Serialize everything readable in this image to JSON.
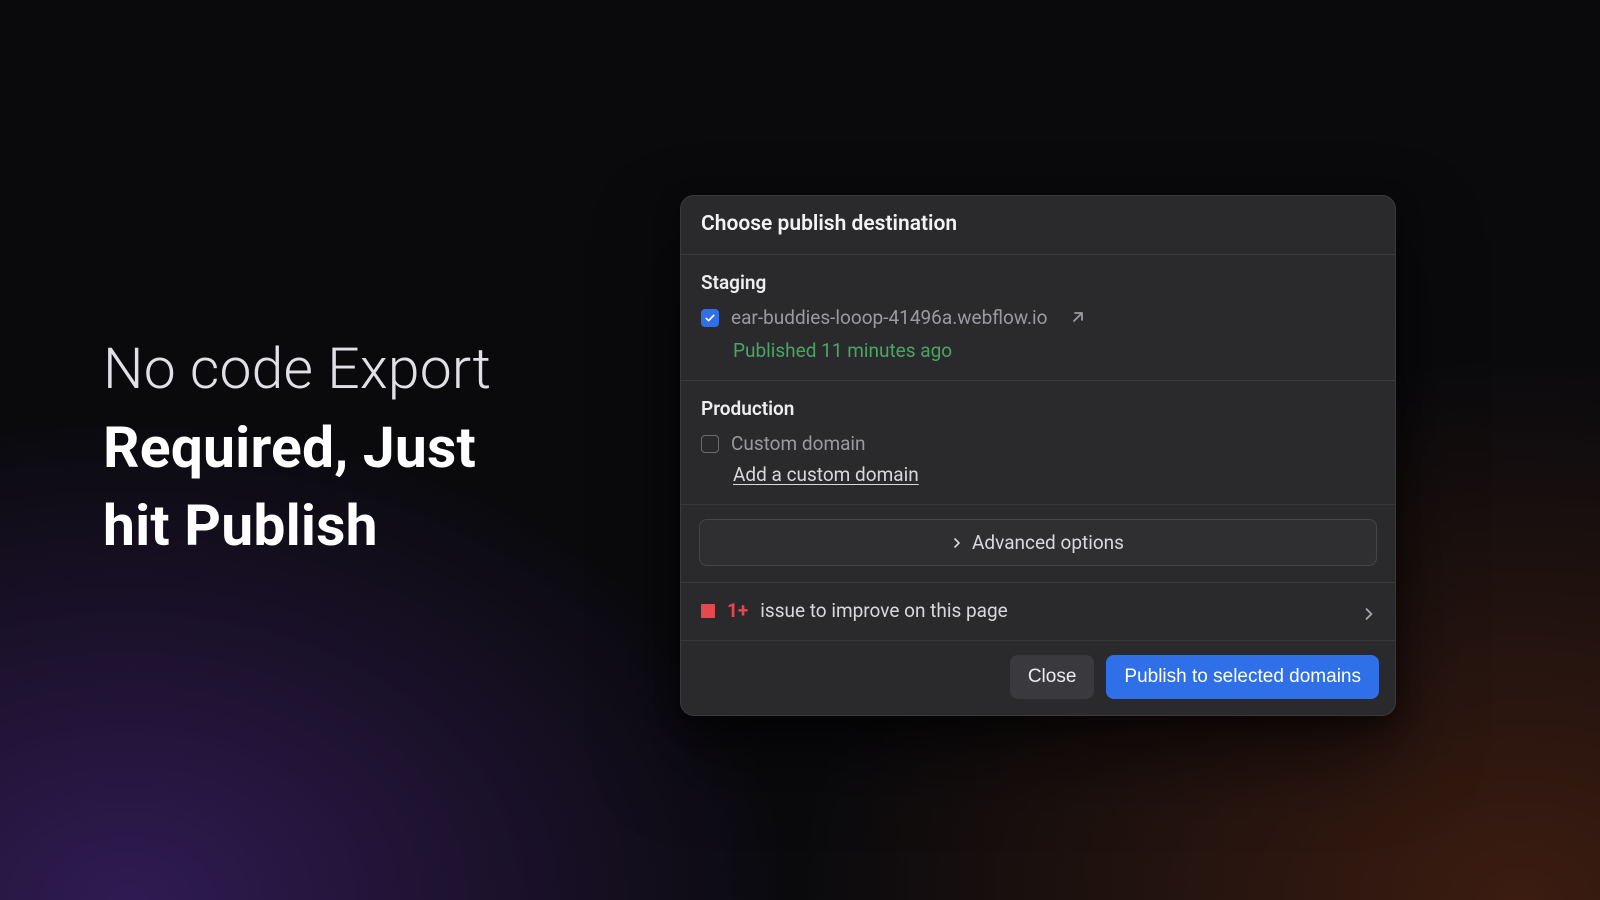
{
  "headline": {
    "line1": "No code Export",
    "line2": "Required, Just",
    "line3": "hit Publish"
  },
  "panel": {
    "title": "Choose publish destination",
    "staging": {
      "heading": "Staging",
      "checked": true,
      "domain": "ear-buddies-looop-41496a.webflow.io",
      "published_status": "Published 11 minutes ago"
    },
    "production": {
      "heading": "Production",
      "checked": false,
      "custom_domain_label": "Custom domain",
      "add_link": "Add a custom domain"
    },
    "advanced_label": "Advanced options",
    "issues": {
      "count_label": "1+",
      "text": "issue to improve on this page"
    },
    "footer": {
      "close": "Close",
      "publish": "Publish to selected domains"
    }
  },
  "colors": {
    "accent_blue": "#2f6fe8",
    "success_green": "#4aa564",
    "danger_red": "#e5484d"
  }
}
